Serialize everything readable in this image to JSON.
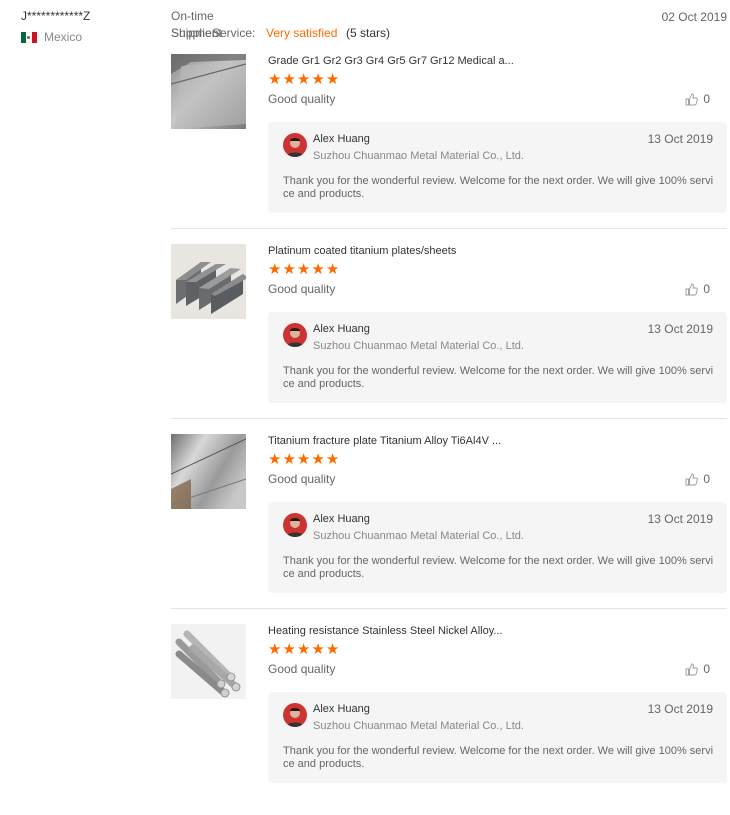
{
  "buyer": {
    "name": "J************Z",
    "country": "Mexico"
  },
  "rating": {
    "label_line1": "On-time",
    "label_a": "Shipment",
    "label_b": "Supplier",
    "service_label": "Service:",
    "verdict": "Very satisfied",
    "stars_text": "(5 stars)"
  },
  "review_date": "02 Oct 2019",
  "items": [
    {
      "title": "Grade Gr1 Gr2 Gr3 Gr4 Gr5 Gr7 Gr12 Medical a...",
      "stars": 5,
      "comment": "Good quality",
      "helpful_count": "0",
      "image": "titanium-sheet-photo",
      "reply": {
        "name": "Alex Huang",
        "company": "Suzhou Chuanmao Metal Material Co., Ltd.",
        "date": "13 Oct 2019",
        "text": "Thank you for the wonderful review. Welcome for the next order. We will give 100% service and products."
      }
    },
    {
      "title": "Platinum coated titanium plates/sheets",
      "stars": 5,
      "comment": "Good quality",
      "helpful_count": "0",
      "image": "titanium-plates-photo",
      "reply": {
        "name": "Alex Huang",
        "company": "Suzhou Chuanmao Metal Material Co., Ltd.",
        "date": "13 Oct 2019",
        "text": "Thank you for the wonderful review. Welcome for the next order. We will give 100% service and products."
      }
    },
    {
      "title": "Titanium fracture plate Titanium Alloy Ti6Al4V ...",
      "stars": 5,
      "comment": "Good quality",
      "helpful_count": "0",
      "image": "titanium-alloy-sheet-photo",
      "reply": {
        "name": "Alex Huang",
        "company": "Suzhou Chuanmao Metal Material Co., Ltd.",
        "date": "13 Oct 2019",
        "text": "Thank you for the wonderful review. Welcome for the next order. We will give 100% service and products."
      }
    },
    {
      "title": "Heating resistance Stainless Steel Nickel Alloy...",
      "stars": 5,
      "comment": "Good quality",
      "helpful_count": "0",
      "image": "metal-rods-photo",
      "reply": {
        "name": "Alex Huang",
        "company": "Suzhou Chuanmao Metal Material Co., Ltd.",
        "date": "13 Oct 2019",
        "text": "Thank you for the wonderful review. Welcome for the next order. We will give 100% service and products."
      }
    }
  ],
  "colors": {
    "accent": "#ff6a00",
    "reply_bg": "#f5f5f5",
    "divider": "#e5e5e5"
  }
}
